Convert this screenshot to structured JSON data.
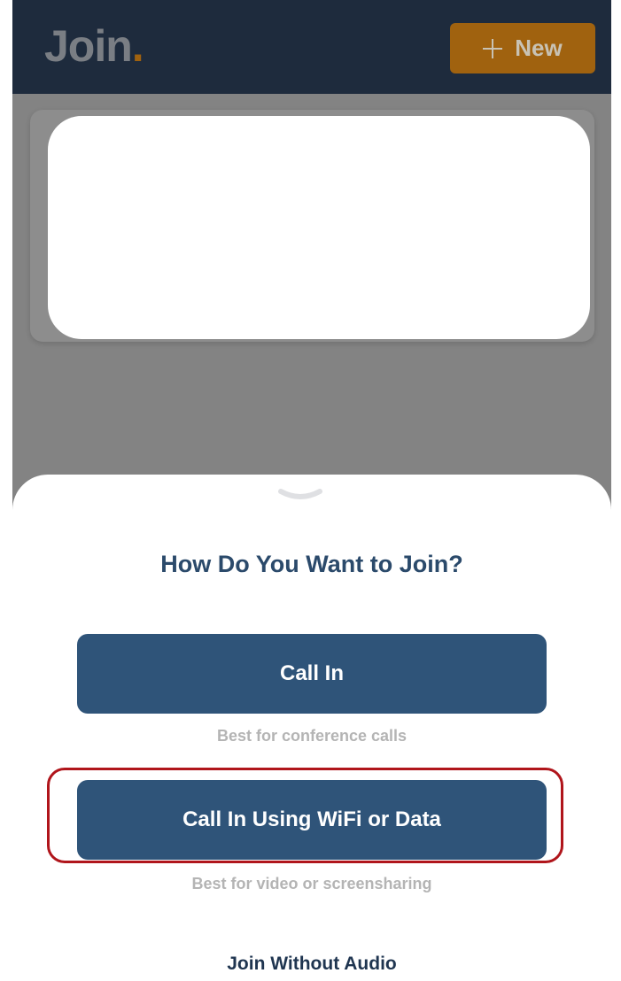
{
  "header": {
    "logo_text": "Join",
    "logo_dot": ".",
    "new_button_label": "New"
  },
  "sheet": {
    "title": "How Do You Want to Join?",
    "options": [
      {
        "label": "Call In",
        "caption": "Best for conference calls"
      },
      {
        "label": "Call In Using WiFi or Data",
        "caption": "Best for video or screensharing"
      }
    ],
    "no_audio_label": "Join Without Audio"
  },
  "colors": {
    "header_bg": "#1e2b3d",
    "accent_orange": "#a0620f",
    "button_blue": "#2f5479",
    "title_blue": "#2b4a6b",
    "highlight_red": "#b0151b",
    "overlay_gray": "#838383"
  },
  "icons": {
    "new_button_icon": "plus-icon",
    "sheet_handle_icon": "chevron-down-icon"
  }
}
